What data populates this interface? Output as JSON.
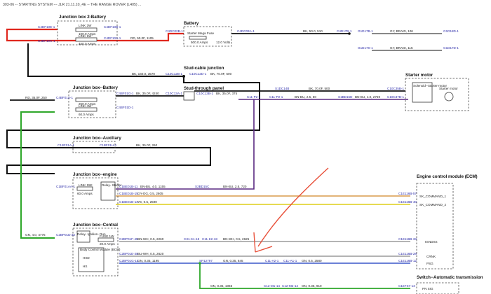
{
  "header": "303-06 -- STARTING SYSTEM --- JLR 21.11.10_4E -- THE RANGE ROVER (L405) ...",
  "colors": {
    "red": "#e0281e",
    "black": "#111111",
    "green": "#2ea82a",
    "purple": "#5a2a82",
    "orange": "#d99a4a",
    "gray": "#9a9a9a",
    "yellow": "#e2d43a",
    "blue": "#3a56c8",
    "annotation": "#e8503a"
  },
  "components": {
    "jb2": {
      "title": "Junction box 2-Battery",
      "link_a": "LINK 2W",
      "amps_a": "100.0 Amps",
      "link_b": "LINK 1W",
      "amps_b": "450.0 Amps",
      "pin_a": "C4DF10E-1",
      "pin_b": "C4DF10C-1",
      "pin_c": "C4DF10B-1",
      "pin_d": "C4DF10A-1"
    },
    "battery": {
      "title": "Battery",
      "fuse": "Starter Mega Fuse",
      "amps": "500.0 Amps",
      "volts": "12.0 Volts",
      "pin_in": "C4DC02B-1",
      "pin_out": "C4DC03A-1"
    },
    "stud_cable": {
      "title": "Stud-cable junction",
      "pin": "C10C12B-1",
      "pin2": "C10C12D-1"
    },
    "stud_panel": {
      "title": "Stud-through panel",
      "pin": "C10C13A-1",
      "pin2": "C10C13B-1"
    },
    "jbb": {
      "title": "Junction box--Battery",
      "pin_in": "C4BF01A-1",
      "pin_out": "C4BF01G-1",
      "pin_b": "C4BF01D-1",
      "amps_a": "250.0 Amps",
      "amps_b": "60.0 Amps",
      "link": "LINK 4W"
    },
    "jba": {
      "title": "Junction box--Auxiliary",
      "pin_a": "C1BF01A-1",
      "pin_b": "C1BF01H-1"
    },
    "jbe": {
      "title": "Junction box--engine",
      "pin_in": "C1BF01AA-1",
      "link": "LINK 15E",
      "amps": "60.0 Amps",
      "relay": "Relay- Starter",
      "pin1": "C1BE01B-11",
      "pin2": "C1BE01B-15",
      "pin3": "C1BE01B-13"
    },
    "jbc": {
      "title": "Junction box--Central",
      "pin_in": "C2BP01D-22",
      "relay": "Relay- Ignition- Run",
      "fuse": "FUSE 1W",
      "amps": "20.0 Amps",
      "bcm": "Body Control Module (BCM)",
      "bcm_gw": "Gateway",
      "pin1": "C2BP01F-45",
      "pin2": "C2BP01E-28",
      "pin3": "C2BP01G-13",
      "lbl_hs": "HSD",
      "lbl_hs2": "HS"
    },
    "starter": {
      "title": "Starter motor",
      "sol": "Solenoid--Starter-motor",
      "motor": "Starter motor",
      "pin": "C10C35B-1",
      "pin2": "C10C37B-1"
    },
    "ecm": {
      "title": "Engine control module (ECM)",
      "p1": "C1E116B-57",
      "p2": "C1E116B-40",
      "p3": "C1E116B-33",
      "p4": "C1E116B-28",
      "p5": "C1E116B-12",
      "s1": "SK_COMMAND_1",
      "s2": "SK_COMMAND_2",
      "s3": "IGNDSS",
      "s4": "CRNK",
      "s5": "PSG"
    },
    "transmission": {
      "title": "Switch--Automatic transmission",
      "pin": "C1E7S7-13",
      "lbl": "PN SIG"
    }
  },
  "wires": {
    "w1": "RD, 50.0F, 1105",
    "w2": "BK, 50.0, 510",
    "w3": "BK, 160.0, 3570",
    "w4": "BK, 70.0F, 500",
    "w5": "RD, 35.0F, 250",
    "w6": "BK, 35.0F, 4240",
    "w7": "BK, 35.0F, 375",
    "w8": "BK, 70.0F, 500",
    "w9": "BN-BU, 2.5, 50",
    "w10": "BN-BU, 4.0, 2759",
    "w11": "BK, 35.0F, 260",
    "w12": "BN-BU, 4.0, 1155",
    "w13": "BN-BU, 2.5, 720",
    "w14": "GY-OG, 0.5, 2605",
    "w15": "YE, 0.5, 2590",
    "w16": "GN, 4.0, 4775",
    "w17": "BN-WH, 0.5, 2260",
    "w18": "BN-WH, 0.5, 2625",
    "w19": "BU-WH, 0.5, 2620",
    "w20": "GN, 0.35, 1195",
    "w21": "GN, 0.35, 845",
    "w22": "GN, 0.5, 2580",
    "w23": "GN, 0.35, 1065",
    "w24": "GN, 0.35, 910",
    "w25": "GY, BRAID, 106",
    "w26": "GY, BRAID, 115"
  },
  "connectors": {
    "c1": "C4D17B-1",
    "c2": "G1D17B-1",
    "c3": "G1D18D-1",
    "c4": "G1D17S-1",
    "c5": "G1D17D-1",
    "c6": "S1DC14B",
    "c7": "C11-P2-1",
    "c8": "C11-P2-1",
    "c9": "S1BD15D",
    "c10": "S2BD15C",
    "c11": "C31-K1-18",
    "c12": "C11-K2-18",
    "c13": "C11-A2-1",
    "c14": "C11-A1-1",
    "c15": "SP12797",
    "c16": "C12-M1-14",
    "c17": "C12-M2-14"
  }
}
